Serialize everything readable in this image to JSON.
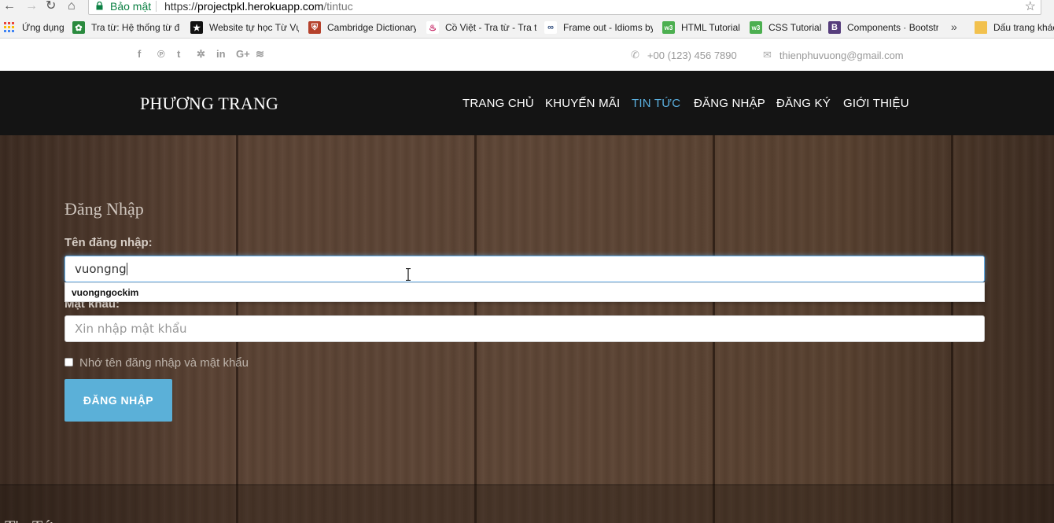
{
  "browser": {
    "security_label": "Bảo mật",
    "url_scheme": "https://",
    "url_host": "projectpkl.herokuapp.com",
    "url_path": "/tintuc",
    "bookmarks": [
      {
        "label": "Ứng dụng",
        "icon": "apps-grid-icon",
        "color": "#e8453c"
      },
      {
        "label": "Tra từ: Hệ thống từ đ",
        "icon": "leaf-icon",
        "color": "#2a8a3e"
      },
      {
        "label": "Website tự học Từ Vự",
        "icon": "star-icon",
        "color": "#111111"
      },
      {
        "label": "Cambridge Dictionary",
        "icon": "shield-icon",
        "color": "#b5412b"
      },
      {
        "label": "Cồ Việt - Tra từ - Tra t",
        "icon": "flame-icon",
        "color": "#c2185b"
      },
      {
        "label": "Frame out - Idioms by",
        "icon": "binoculars-icon",
        "color": "#2d4a7a"
      },
      {
        "label": "HTML Tutorial",
        "icon": "w3-icon",
        "color": "#4caf50"
      },
      {
        "label": "CSS Tutorial",
        "icon": "w3-icon",
        "color": "#4caf50"
      },
      {
        "label": "Components · Bootstr",
        "icon": "bootstrap-icon",
        "color": "#563d7c"
      },
      {
        "label": "Dấu trang khác",
        "icon": "folder-icon",
        "color": "#f2c14e"
      }
    ],
    "more_label": "»"
  },
  "topbar": {
    "social": [
      "f",
      "℗",
      "t",
      "✲",
      "in",
      "G+",
      "≋"
    ],
    "phone": "+00 (123) 456 7890",
    "email": "thienphuvuong@gmail.com"
  },
  "header": {
    "brand": "PHƯƠNG TRANG",
    "menu": [
      {
        "label": "TRANG CHỦ"
      },
      {
        "label": "KHUYẾN MÃI"
      },
      {
        "label": "TIN TỨC"
      },
      {
        "label": "ĐĂNG NHẬP"
      },
      {
        "label": "ĐĂNG KÝ"
      },
      {
        "label": "GIỚI THIỆU"
      }
    ],
    "active_color": "#5bb0e0"
  },
  "login": {
    "title": "Đăng Nhập",
    "username_label": "Tên đăng nhập:",
    "username_value": "vuongng",
    "autocomplete_suggestion": "vuongngockim",
    "password_label": "Mật khẩu:",
    "password_placeholder": "Xin nhập mật khẩu",
    "remember_label": "Nhớ tên đăng nhập và mật khẩu",
    "submit_label": "ĐĂNG NHẬP",
    "button_color": "#5bb0d8"
  },
  "next_section_title": "Tin Tức"
}
